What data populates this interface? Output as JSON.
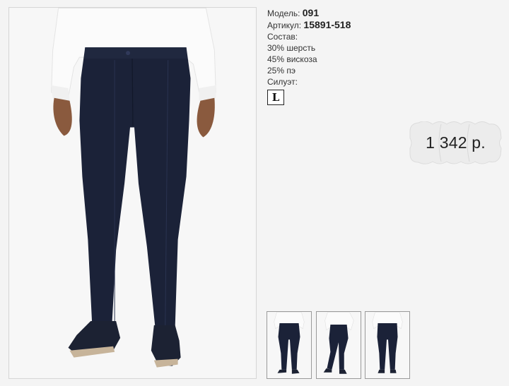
{
  "product": {
    "model_label": "Модель:",
    "model_value": "091",
    "article_label": "Артикул:",
    "article_value": "15891-518",
    "composition_label": "Состав:",
    "composition": [
      "30% шерсть",
      "45% вискоза",
      "25% пэ"
    ],
    "silhouette_label": "Силуэт:",
    "silhouette_value": "L"
  },
  "price": {
    "text": "1 342 р."
  },
  "images": {
    "main": "navy-trousers-front-icon",
    "thumbs": [
      {
        "name": "navy-trousers-front-icon"
      },
      {
        "name": "navy-trousers-side-icon"
      },
      {
        "name": "navy-trousers-back-icon"
      }
    ]
  },
  "colors": {
    "trousers": "#1b2238",
    "shirt": "#f7f7f7",
    "shoes": "#1c2233",
    "background": "#f4f4f4"
  }
}
